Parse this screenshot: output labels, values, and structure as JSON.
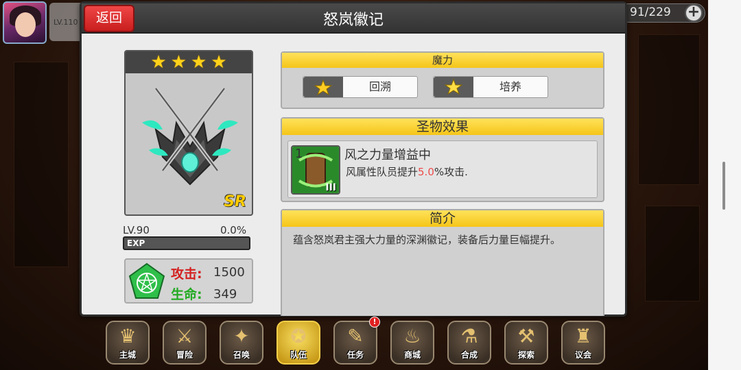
{
  "hud": {
    "player_level": "LV.110",
    "resource_count": "91/229"
  },
  "dialog": {
    "title": "怒岚徽记",
    "back_label": "返回"
  },
  "item": {
    "star_count": 4,
    "rarity": "SR",
    "level": "LV.90",
    "exp_percent": "0.0%",
    "exp_fraction": 0.0,
    "exp_label": "EXP",
    "attack_label": "攻击:",
    "attack_value": "1500",
    "hp_label": "生命:",
    "hp_value": "349"
  },
  "magic": {
    "title": "魔力",
    "rewind_label": "回溯",
    "train_label": "培养"
  },
  "effect": {
    "title": "圣物效果",
    "rank": "1",
    "tier": "III",
    "name": "风之力量增益中",
    "desc_prefix": "风属性队员提升",
    "desc_value": "5.0",
    "desc_suffix": "%攻击."
  },
  "intro": {
    "title": "简介",
    "text": "蕴含怒岚君主强大力量的深渊徽记，装备后力量巨幅提升。"
  },
  "nav": [
    {
      "label": "主城",
      "active": false,
      "badge": ""
    },
    {
      "label": "冒险",
      "active": false,
      "badge": ""
    },
    {
      "label": "召唤",
      "active": false,
      "badge": ""
    },
    {
      "label": "队伍",
      "active": true,
      "badge": ""
    },
    {
      "label": "任务",
      "active": false,
      "badge": "!"
    },
    {
      "label": "商城",
      "active": false,
      "badge": ""
    },
    {
      "label": "合成",
      "active": false,
      "badge": ""
    },
    {
      "label": "探索",
      "active": false,
      "badge": ""
    },
    {
      "label": "议会",
      "active": false,
      "badge": ""
    }
  ],
  "colors": {
    "accent_yellow": "#f5c518",
    "back_red": "#e03030",
    "attack_red": "#d42020",
    "hp_green": "#22aa22",
    "highlight": "#ee4b4b"
  }
}
